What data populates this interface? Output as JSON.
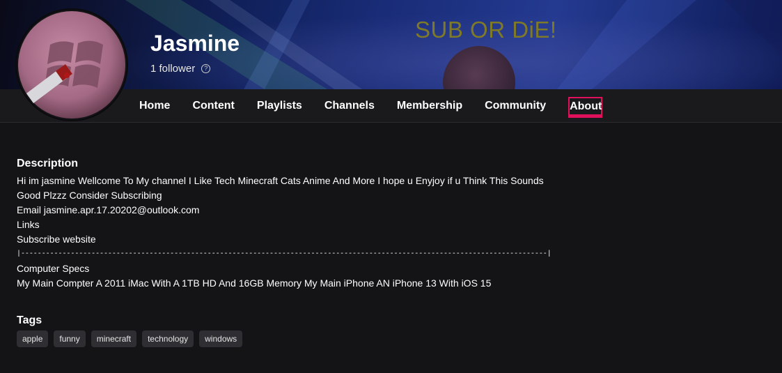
{
  "channel": {
    "name": "Jasmine",
    "followers": "1 follower",
    "banner_slogan": "SUB OR DiE!",
    "accent_color": "#e0105a"
  },
  "nav": {
    "tabs": [
      {
        "label": "Home"
      },
      {
        "label": "Content"
      },
      {
        "label": "Playlists"
      },
      {
        "label": "Channels"
      },
      {
        "label": "Membership"
      },
      {
        "label": "Community"
      },
      {
        "label": "About",
        "active": true
      }
    ]
  },
  "about": {
    "description_heading": "Description",
    "description_lines": [
      "Hi im jasmine Wellcome To My channel I Like Tech Minecraft Cats Anime And More I hope u Enyjoy if u Think This Sounds",
      "Good Plzzz Consider Subscribing",
      "Email jasmine.apr.17.20202@outlook.com",
      "Links",
      "Subscribe website",
      "|-------------------------------------------------------------------------------------------------------------------------------|",
      "Computer Specs",
      "My Main Compter A 2011 iMac With A 1TB HD And 16GB Memory My Main iPhone AN iPhone 13 With iOS 15"
    ],
    "tags_heading": "Tags",
    "tags": [
      "apple",
      "funny",
      "minecraft",
      "technology",
      "windows"
    ]
  },
  "icons": {
    "help": "help-circle-icon",
    "avatar": "windows-logo-icon"
  }
}
